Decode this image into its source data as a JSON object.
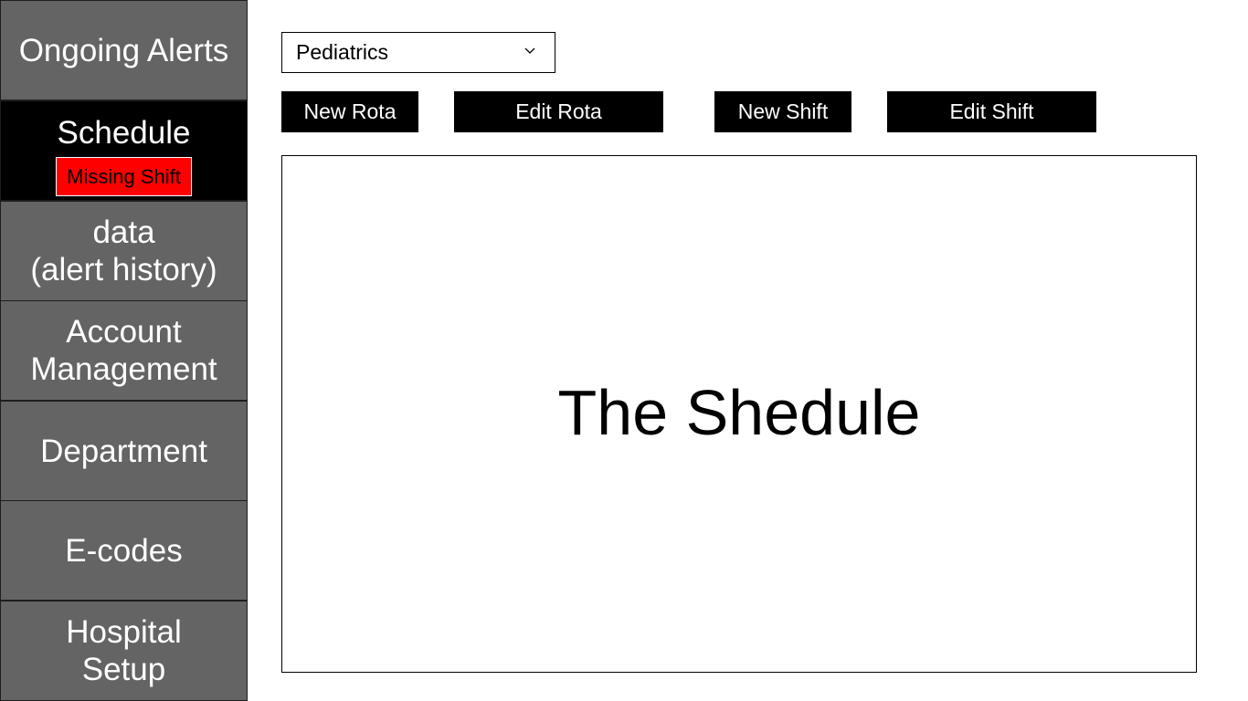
{
  "sidebar": {
    "items": [
      {
        "label": "Ongoing Alerts"
      },
      {
        "label": "Schedule",
        "badge": "Missing Shift",
        "active": true
      },
      {
        "label": "data\n(alert history)"
      },
      {
        "label": "Account\nManagement"
      },
      {
        "label": "Department"
      },
      {
        "label": "E-codes"
      },
      {
        "label": "Hospital\nSetup"
      }
    ]
  },
  "department_select": {
    "value": "Pediatrics",
    "icon": "chevron-down-icon"
  },
  "toolbar": {
    "new_rota": "New Rota",
    "edit_rota": "Edit Rota",
    "new_shift": "New Shift",
    "edit_shift": "Edit Shift"
  },
  "schedule": {
    "placeholder": "The Shedule"
  },
  "colors": {
    "sidebar_bg": "#646464",
    "active_bg": "#000000",
    "badge_bg": "#ff0000",
    "button_bg": "#000000"
  }
}
